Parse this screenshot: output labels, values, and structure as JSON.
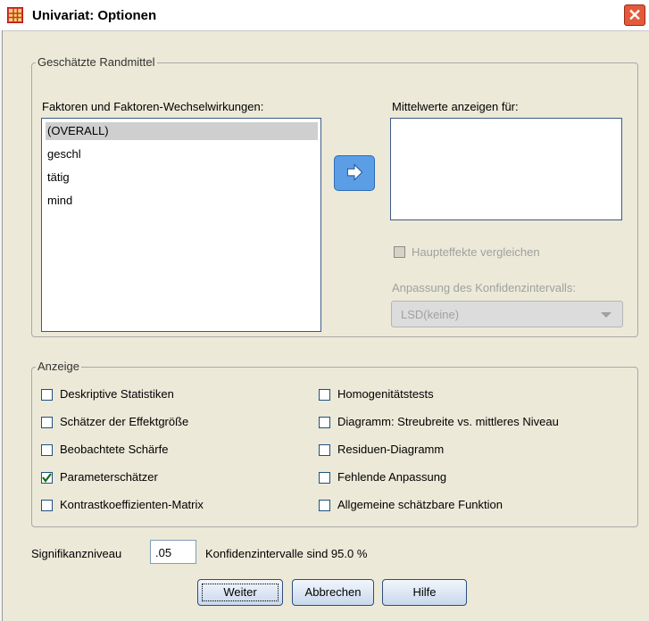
{
  "window": {
    "title": "Univariat: Optionen",
    "close_glyph": "✕"
  },
  "estimated_means": {
    "group_label": "Geschätzte Randmittel",
    "factors_label": "Faktoren und Faktoren-Wechselwirkungen:",
    "factors": [
      "(OVERALL)",
      "geschl",
      "tätig",
      "mind"
    ],
    "selected_index": 0,
    "display_means_label": "Mittelwerte anzeigen für:",
    "compare_main_effects": "Haupteffekte vergleichen",
    "ci_adjustment_label": "Anpassung des Konfidenzintervalls:",
    "ci_adjustment_value": "LSD(keine)",
    "move_arrow_icon": "right-arrow-icon"
  },
  "display": {
    "group_label": "Anzeige",
    "left": [
      {
        "label": "Deskriptive Statistiken",
        "checked": false
      },
      {
        "label": "Schätzer der Effektgröße",
        "checked": false
      },
      {
        "label": "Beobachtete Schärfe",
        "checked": false
      },
      {
        "label": "Parameterschätzer",
        "checked": true
      },
      {
        "label": "Kontrastkoeffizienten-Matrix",
        "checked": false
      }
    ],
    "right": [
      {
        "label": "Homogenitätstests",
        "checked": false
      },
      {
        "label": "Diagramm: Streubreite vs. mittleres Niveau",
        "checked": false
      },
      {
        "label": "Residuen-Diagramm",
        "checked": false
      },
      {
        "label": "Fehlende Anpassung",
        "checked": false
      },
      {
        "label": "Allgemeine schätzbare Funktion",
        "checked": false
      }
    ]
  },
  "significance": {
    "label": "Signifikanzniveau",
    "value": ".05",
    "ci_text": "Konfidenzintervalle sind 95.0 %"
  },
  "buttons": {
    "continue": "Weiter",
    "cancel": "Abbrechen",
    "help": "Hilfe"
  },
  "colors": {
    "accent": "#5b9ee6",
    "close": "#e25a3b"
  }
}
